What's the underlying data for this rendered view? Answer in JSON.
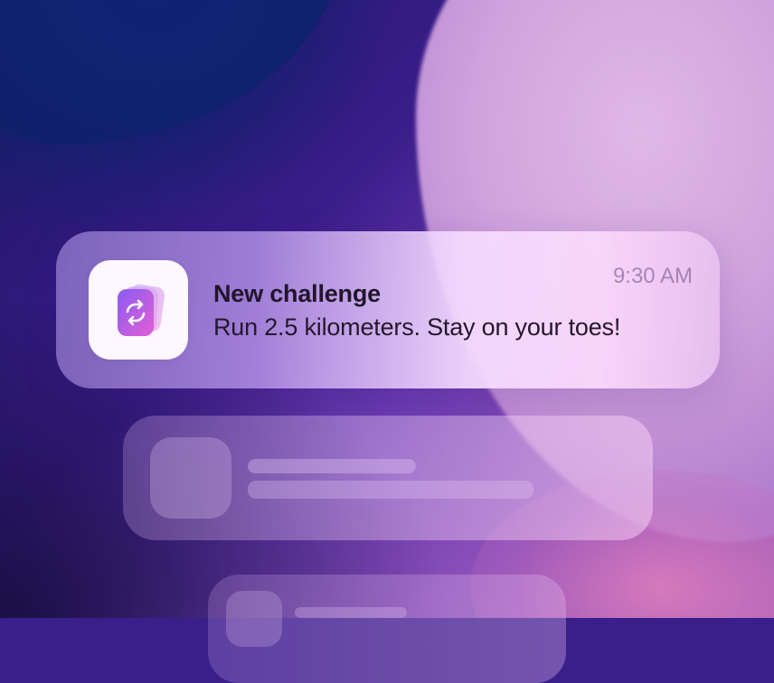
{
  "notification": {
    "app_icon": "repeat-cards-icon",
    "title": "New challenge",
    "body": "Run 2.5 kilometers. Stay on your toes!",
    "time": "9:30 AM"
  },
  "colors": {
    "accent": "#b64fe0",
    "title_text": "#22152c",
    "time_text": "#8c6ea0",
    "wallpaper_dark": "#12206f",
    "wallpaper_light": "#e0b8e6"
  }
}
